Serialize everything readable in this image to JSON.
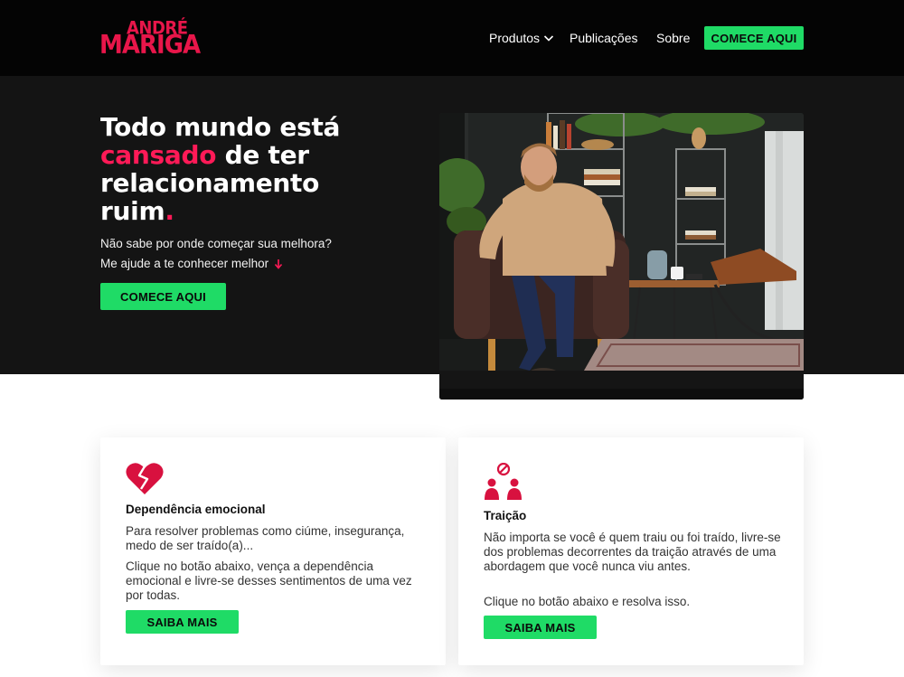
{
  "header": {
    "logo": {
      "line1": "ANDRÉ",
      "line2": "MARIGA"
    },
    "nav": {
      "produtos": "Produtos",
      "publicacoes": "Publicações",
      "sobre": "Sobre"
    },
    "cta": "COMECE AQUI"
  },
  "hero": {
    "headline_part1": "Todo mundo está",
    "headline_accent": "cansado",
    "headline_part2": " de ter relacionamento ruim",
    "headline_dot": ".",
    "subtitle_line1": "Não sabe por onde começar sua melhora?",
    "subtitle_line2": "Me ajude a te conhecer melhor",
    "cta": "COMECE AQUI"
  },
  "cards": [
    {
      "icon": "broken-heart-icon",
      "title": "Dependência emocional",
      "text1": "Para resolver problemas como ciúme, insegurança, medo de ser traído(a)...",
      "text2": "Clique no botão abaixo, vença a dependência emocional e livre-se desses sentimentos de uma vez por todas.",
      "button": "SAIBA MAIS"
    },
    {
      "icon": "betrayal-people-icon",
      "title": "Traição",
      "text1": "Não importa se você é quem traiu ou foi traído, livre-se dos problemas decorrentes da traição através de uma abordagem que você nunca viu antes.",
      "text2": "Clique no botão abaixo e resolva isso.",
      "button": "SAIBA MAIS"
    }
  ],
  "colors": {
    "accent": "#ff1a57",
    "cta_green": "#1fdb66",
    "header_bg": "#040404",
    "hero_bg": "#141414"
  }
}
